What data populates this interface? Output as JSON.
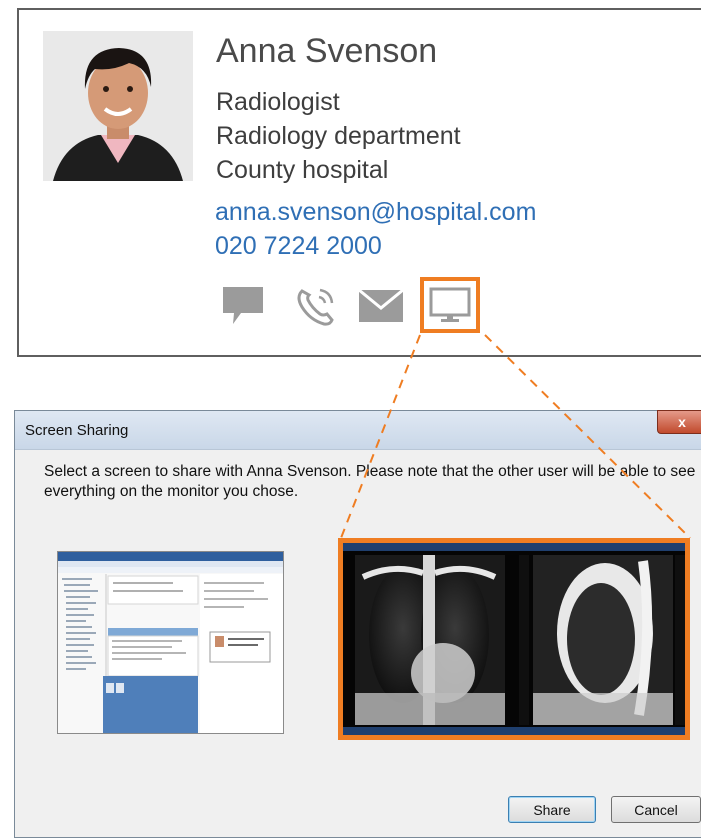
{
  "contact": {
    "name": "Anna Svenson",
    "title": "Radiologist",
    "department": "Radiology department",
    "organization": "County hospital",
    "email": "anna.svenson@hospital.com",
    "phone": "020 7224 2000",
    "actions": [
      {
        "icon": "chat-bubble-icon"
      },
      {
        "icon": "phone-icon"
      },
      {
        "icon": "envelope-icon"
      },
      {
        "icon": "monitor-icon",
        "highlighted": true
      }
    ]
  },
  "dialog": {
    "title": "Screen Sharing",
    "close_glyph": "x",
    "instruction": "Select a screen to share with Anna Svenson.  Please note that the other user will be able to see everything on the monitor you chose.",
    "monitors": [
      {
        "content": "application window"
      },
      {
        "content": "chest x-ray images",
        "selected": true
      }
    ],
    "share_label": "Share",
    "cancel_label": "Cancel"
  },
  "colors": {
    "highlight": "#ef7d22",
    "link": "#2f6fb5",
    "icon_gray": "#9b9b9b"
  }
}
